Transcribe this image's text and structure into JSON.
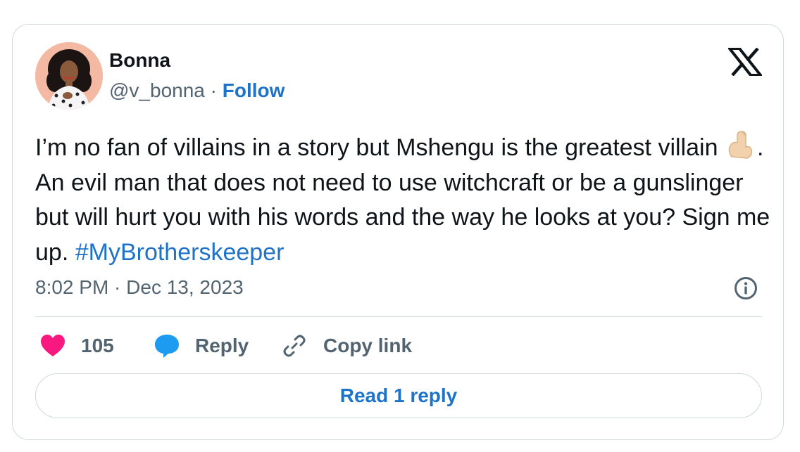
{
  "author": {
    "name": "Bonna",
    "handle": "@v_bonna",
    "separator": " · ",
    "follow_label": "Follow"
  },
  "logo_icon": "x-logo-icon",
  "tweet": {
    "text_part1": "I’m no fan of villains in a story but Mshengu is the greatest villain ",
    "emoji_icon": "pinched-fingers-emoji",
    "text_part2": ". An evil man that does not need to use witchcraft or be a gunslinger but will hurt you with his words and the way he looks at you? Sign me up. ",
    "hashtag": "#MyBrotherskeeper"
  },
  "timestamp": "8:02 PM · Dec 13, 2023",
  "info_icon": "info-icon",
  "actions": {
    "like_count": "105",
    "reply_label": "Reply",
    "copy_label": "Copy link"
  },
  "read_reply_label": "Read 1 reply",
  "colors": {
    "link": "#1d73c9",
    "like": "#f91880",
    "reply": "#1d9bf0",
    "muted": "#536471",
    "border": "#cfd9de"
  }
}
